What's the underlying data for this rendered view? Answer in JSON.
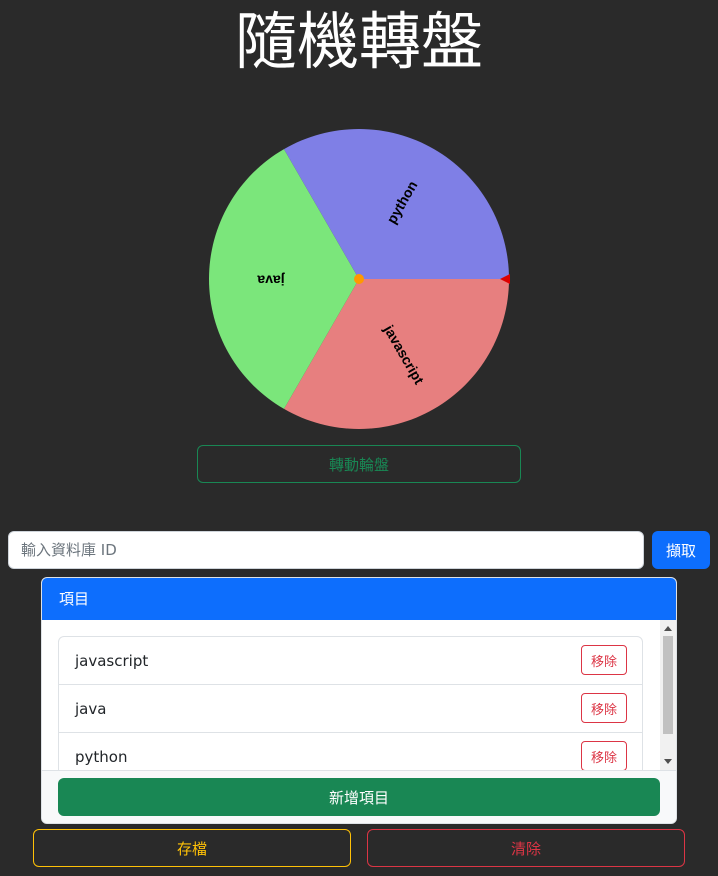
{
  "title": "隨機轉盤",
  "wheel": {
    "segments": [
      {
        "label": "javascript",
        "color": "#e77f7f"
      },
      {
        "label": "java",
        "color": "#7be67b"
      },
      {
        "label": "python",
        "color": "#7f7fe6"
      }
    ],
    "center_color": "#ff9900",
    "pointer_color": "#dd0000",
    "label_color": "#000000"
  },
  "spin_button": "轉動輪盤",
  "id_input": {
    "placeholder": "輸入資料庫 ID",
    "value": ""
  },
  "fetch_button": "擷取",
  "items_card": {
    "header": "項目",
    "items": [
      {
        "label": "javascript",
        "remove": "移除"
      },
      {
        "label": "java",
        "remove": "移除"
      },
      {
        "label": "python",
        "remove": "移除"
      }
    ],
    "add_button": "新增項目"
  },
  "save_button": "存檔",
  "clear_button": "清除",
  "colors": {
    "background": "#2a2a2a",
    "primary": "#0d6efd",
    "success": "#198754",
    "warning": "#ffc107",
    "danger": "#dc3545"
  }
}
